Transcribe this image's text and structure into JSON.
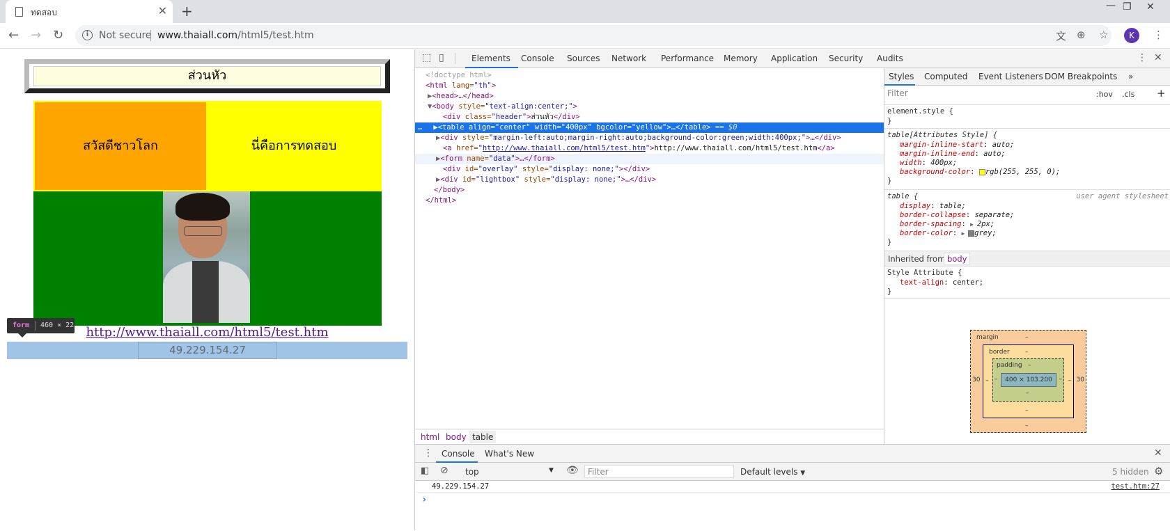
{
  "browser": {
    "tab_title": "ทดสอบ",
    "new_tab": "+",
    "not_secure": "Not secure",
    "url_host": "www.thaiall.com",
    "url_path": "/html5/test.htm",
    "avatar_letter": "K"
  },
  "page": {
    "header_text": "ส่วนหัว",
    "cell_1": "สวัสดีชาวโลก",
    "cell_2": "นี่คือการทดสอบ",
    "link_text": "http://www.thaiall.com/html5/test.htm",
    "ip_value": "49.229.154.27",
    "tooltip_tag": "form",
    "tooltip_dims": "460 × 22"
  },
  "devtools": {
    "tabs": [
      "Elements",
      "Console",
      "Sources",
      "Network",
      "Performance",
      "Memory",
      "Application",
      "Security",
      "Audits"
    ],
    "active_tab": "Elements",
    "dom": {
      "l1": "<!doctype html>",
      "l2_tag": "<html",
      "l2_attr": " lang=",
      "l2_val": "\"th\"",
      "l2_end": ">",
      "l3": "<head>…</head>",
      "l4_tag": "<body",
      "l4_attr": " style=",
      "l4_val": "\"text-align:center;\"",
      "l4_end": ">",
      "l5_tag": "<div",
      "l5_attr": " class=",
      "l5_val": "\"header\"",
      "l5_text": "ส่วนหัว",
      "l5_close": "</div>",
      "l6": "<table align=\"center\" width=\"400px\" bgcolor=\"yellow\">…</table>",
      "l6_eq": " == $0",
      "l7_tag": "<div",
      "l7_attr": " style=",
      "l7_val": "\"margin-left:auto;margin-right:auto;background-color:green;width:400px;\"",
      "l7_end": ">…</div>",
      "l8_tag": "<a",
      "l8_attr": " href=",
      "l8_val": "http://www.thaiall.com/html5/test.htm",
      "l8_text": "http://www.thaiall.com/html5/test.htm",
      "l8_close": "</a>",
      "l9_tag": "<form",
      "l9_attr": " name=",
      "l9_val": "\"data\"",
      "l9_end": ">…</form>",
      "l10_tag": "<div",
      "l10_attr1": " id=",
      "l10_val1": "\"overlay\"",
      "l10_attr2": " style=",
      "l10_val2": "\"display: none;\"",
      "l10_end": "></div>",
      "l11_tag": "<div",
      "l11_attr1": " id=",
      "l11_val1": "\"lightbox\"",
      "l11_attr2": " style=",
      "l11_val2": "\"display: none;\"",
      "l11_end": ">…</div>",
      "l12": "</body>",
      "l13": "</html>"
    },
    "breadcrumbs": [
      "html",
      "body",
      "table"
    ],
    "styles_tabs": [
      "Styles",
      "Computed",
      "Event Listeners",
      "DOM Breakpoints",
      "»"
    ],
    "filter_placeholder": "Filter",
    "hov": ":hov",
    "cls": ".cls",
    "plus": "+",
    "element_style": "element.style {",
    "close_brace": "}",
    "rule2_selector": "table[Attributes Style] {",
    "rule2_props": [
      {
        "name": "margin-inline-start",
        "value": "auto;"
      },
      {
        "name": "margin-inline-end",
        "value": "auto;"
      },
      {
        "name": "width",
        "value": "400px;"
      },
      {
        "name": "background-color",
        "value": "rgb(255, 255, 0);"
      }
    ],
    "rule3_selector": "table {",
    "rule3_source": "user agent stylesheet",
    "rule3_props": [
      {
        "name": "display",
        "value": "table;"
      },
      {
        "name": "border-collapse",
        "value": "separate;"
      },
      {
        "name": "border-spacing",
        "value": "2px;"
      },
      {
        "name": "border-color",
        "value": "grey;"
      }
    ],
    "inherited_label": "Inherited from",
    "inherited_tag": "body",
    "rule4_selector": "Style Attribute {",
    "rule4_prop_name": "text-align",
    "rule4_prop_value": "center;",
    "box": {
      "margin_label": "margin",
      "border_label": "border",
      "padding_label": "padding",
      "dash": "–",
      "left": "30",
      "right": "30",
      "content": "400 × 103.200"
    },
    "drawer_tabs": [
      "Console",
      "What's New"
    ],
    "context": "top",
    "console_filter": "Filter",
    "levels": "Default levels",
    "hidden": "5 hidden",
    "log_value": "49.229.154.27",
    "log_source": "test.htm:27",
    "prompt": "›"
  }
}
